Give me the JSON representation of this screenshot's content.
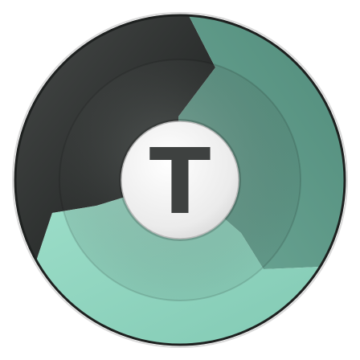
{
  "icon": {
    "letter": "T",
    "icon_name": "teracopy-logo-icon",
    "colors": {
      "dark_segment": "#2f3231",
      "teal_segment": "#5d9a89",
      "mint_segment": "#8fd6bf",
      "center_disc": "#eeeeee",
      "letter": "#3e4140",
      "outline": "#1e2120"
    }
  }
}
